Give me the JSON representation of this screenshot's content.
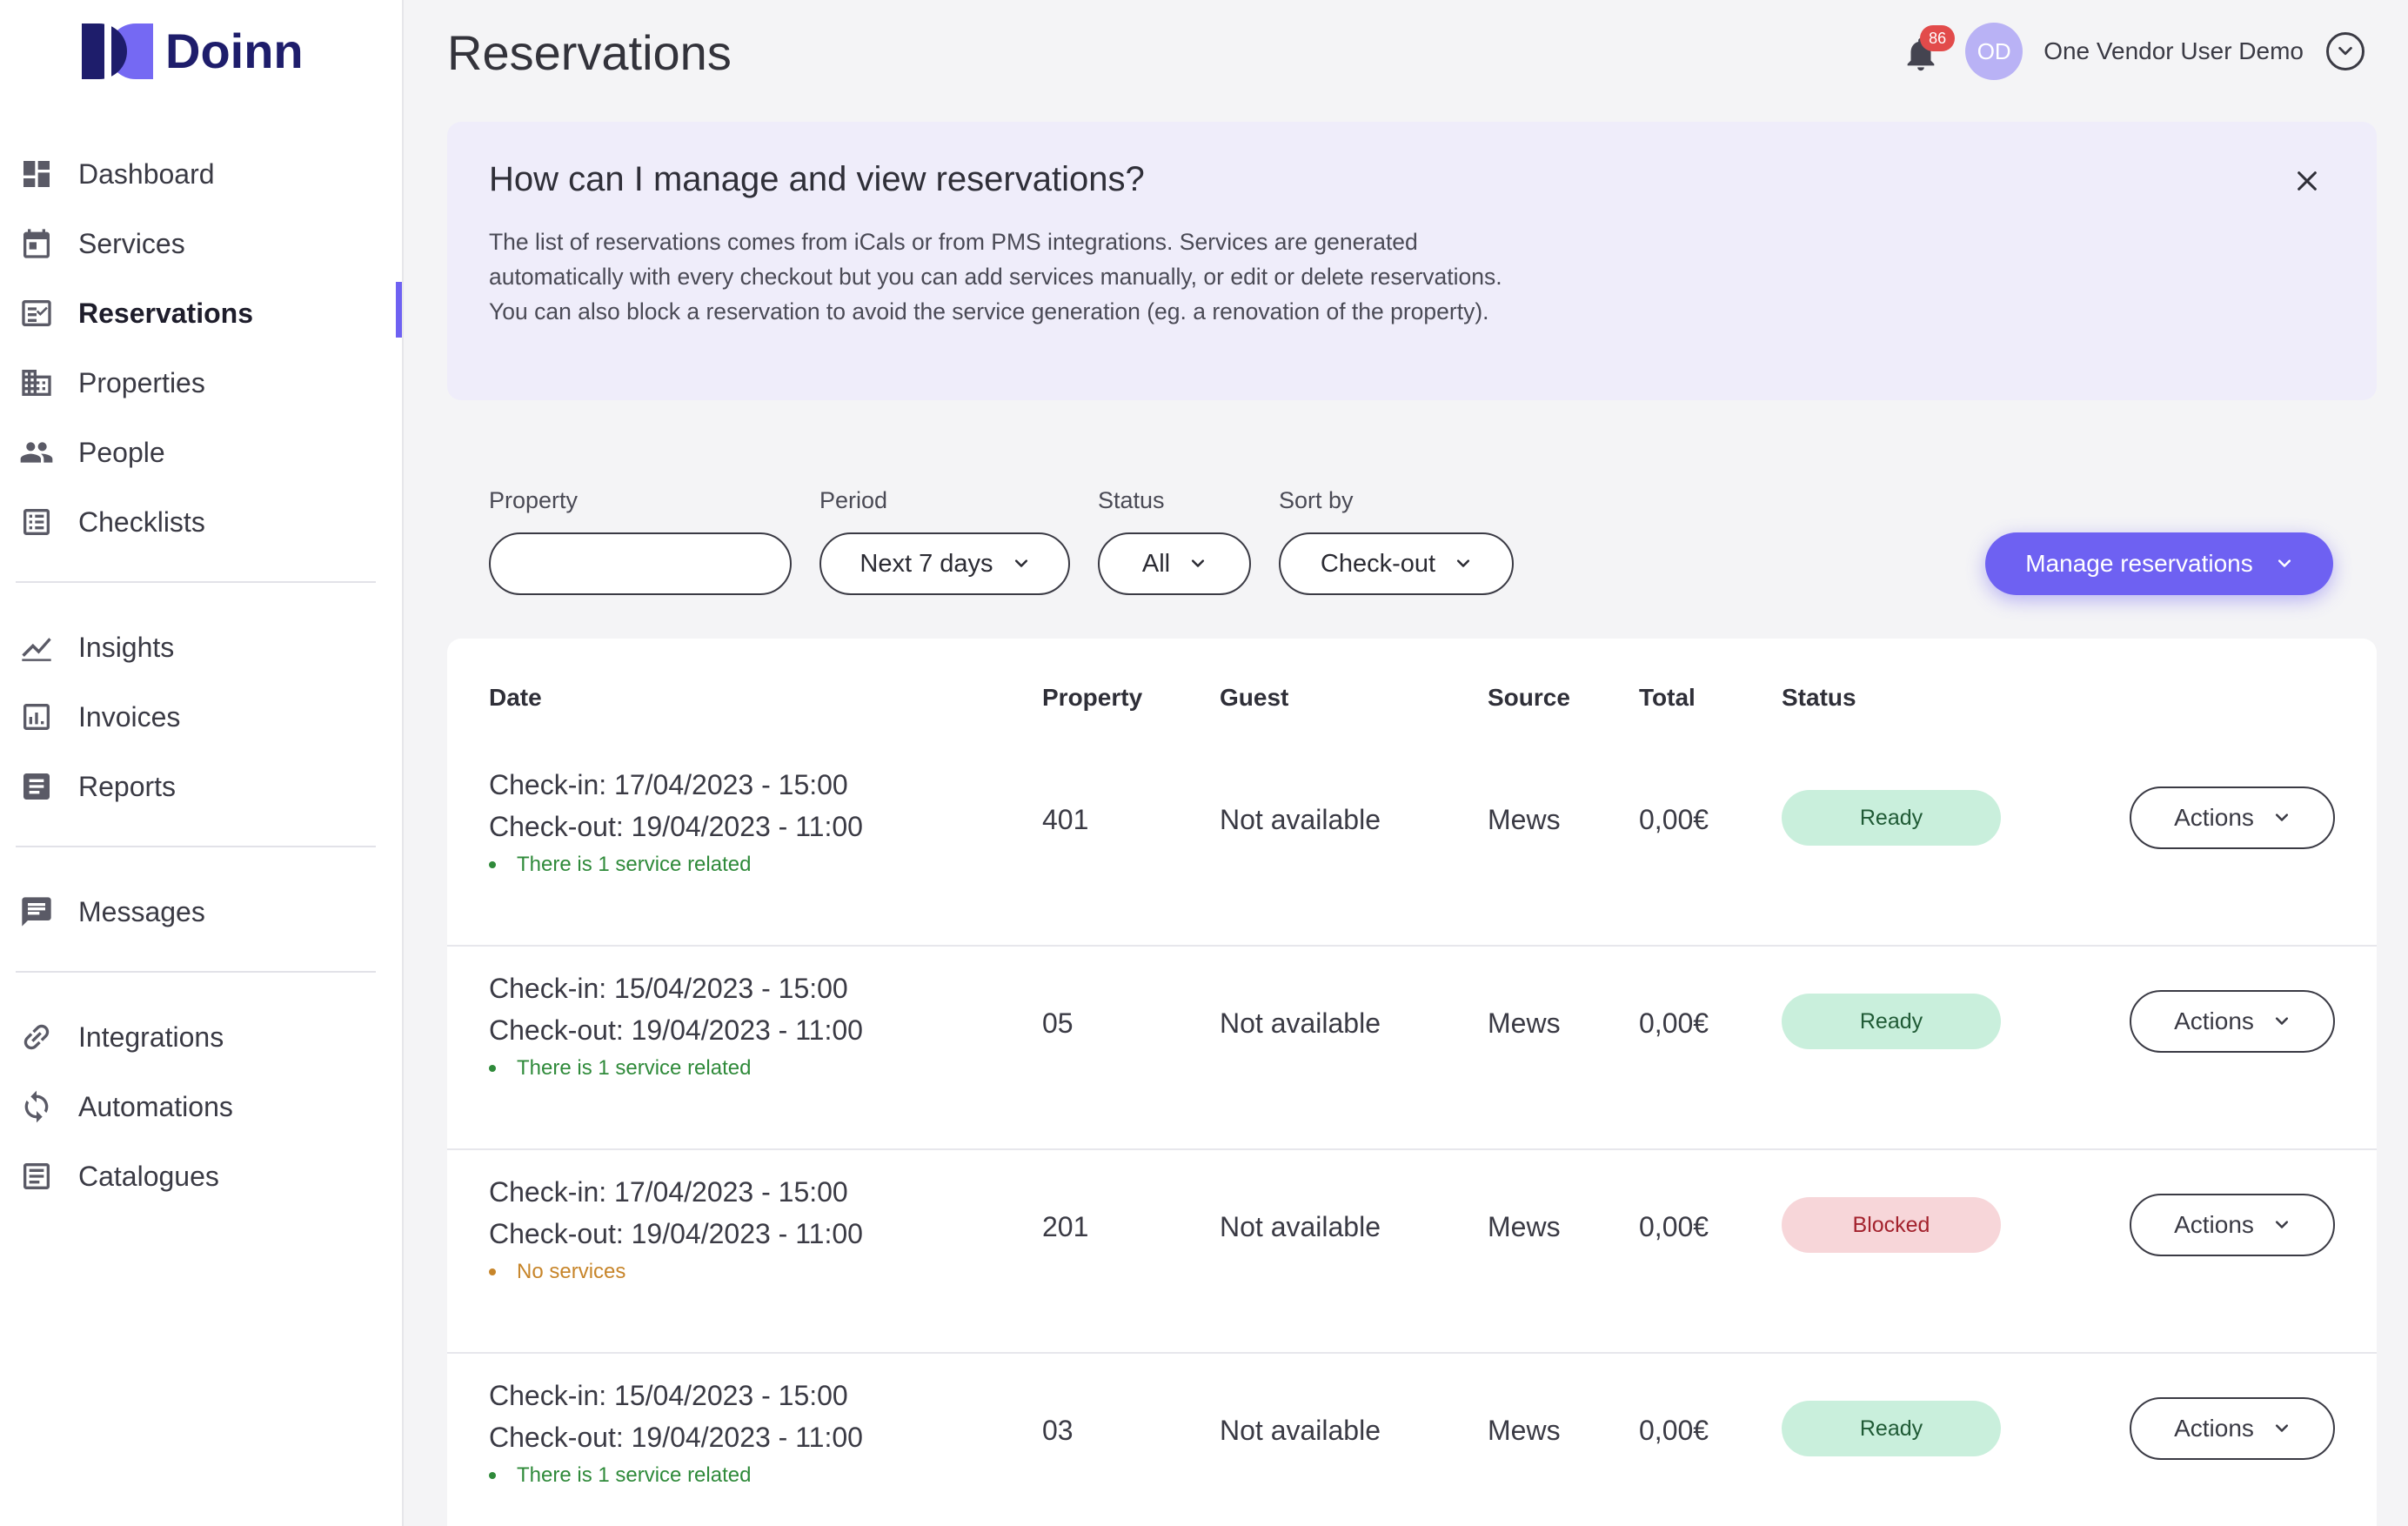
{
  "brand": {
    "name": "Doinn"
  },
  "sidebar": {
    "groups": [
      [
        {
          "label": "Dashboard",
          "icon": "dashboard-icon",
          "active": false
        },
        {
          "label": "Services",
          "icon": "calendar-icon",
          "active": false
        },
        {
          "label": "Reservations",
          "icon": "reservations-icon",
          "active": true
        },
        {
          "label": "Properties",
          "icon": "building-icon",
          "active": false
        },
        {
          "label": "People",
          "icon": "people-icon",
          "active": false
        },
        {
          "label": "Checklists",
          "icon": "checklist-icon",
          "active": false
        }
      ],
      [
        {
          "label": "Insights",
          "icon": "chart-line-icon",
          "active": false
        },
        {
          "label": "Invoices",
          "icon": "invoice-icon",
          "active": false
        },
        {
          "label": "Reports",
          "icon": "report-icon",
          "active": false
        }
      ],
      [
        {
          "label": "Messages",
          "icon": "message-icon",
          "active": false
        }
      ],
      [
        {
          "label": "Integrations",
          "icon": "link-icon",
          "active": false
        },
        {
          "label": "Automations",
          "icon": "sync-icon",
          "active": false
        },
        {
          "label": "Catalogues",
          "icon": "catalogue-icon",
          "active": false
        }
      ]
    ]
  },
  "header": {
    "title": "Reservations",
    "notifications_count": "86",
    "user_initials": "OD",
    "user_name": "One Vendor User Demo"
  },
  "info": {
    "title": "How can I manage and view reservations?",
    "lines": [
      "The list of reservations comes from iCals or from PMS integrations. Services are generated",
      "automatically with every checkout but you can add services manually, or edit or delete reservations.",
      "You can also block a reservation to avoid the service generation (eg. a renovation of the property)."
    ]
  },
  "filters": {
    "property": {
      "label": "Property",
      "value": ""
    },
    "period": {
      "label": "Period",
      "value": "Next 7 days"
    },
    "status": {
      "label": "Status",
      "value": "All"
    },
    "sort_by": {
      "label": "Sort by",
      "value": "Check-out"
    }
  },
  "manage_button": "Manage reservations",
  "table": {
    "headers": {
      "date": "Date",
      "property": "Property",
      "guest": "Guest",
      "source": "Source",
      "total": "Total",
      "status": "Status"
    },
    "rows": [
      {
        "checkin": "Check-in: 17/04/2023 - 15:00",
        "checkout": "Check-out: 19/04/2023 - 11:00",
        "note": "There is 1 service related",
        "note_type": "green",
        "property": "401",
        "guest": "Not available",
        "source": "Mews",
        "total": "0,00€",
        "status": "Ready",
        "status_type": "ready",
        "actions": "Actions"
      },
      {
        "checkin": "Check-in: 15/04/2023 - 15:00",
        "checkout": "Check-out: 19/04/2023 - 11:00",
        "note": "There is 1 service related",
        "note_type": "green",
        "property": "05",
        "guest": "Not available",
        "source": "Mews",
        "total": "0,00€",
        "status": "Ready",
        "status_type": "ready",
        "actions": "Actions"
      },
      {
        "checkin": "Check-in: 17/04/2023 - 15:00",
        "checkout": "Check-out: 19/04/2023 - 11:00",
        "note": "No services",
        "note_type": "orange",
        "property": "201",
        "guest": "Not available",
        "source": "Mews",
        "total": "0,00€",
        "status": "Blocked",
        "status_type": "blocked",
        "actions": "Actions"
      },
      {
        "checkin": "Check-in: 15/04/2023 - 15:00",
        "checkout": "Check-out: 19/04/2023 - 11:00",
        "note": "There is 1 service related",
        "note_type": "green",
        "property": "03",
        "guest": "Not available",
        "source": "Mews",
        "total": "0,00€",
        "status": "Ready",
        "status_type": "ready",
        "actions": "Actions"
      }
    ]
  },
  "colors": {
    "accent": "#6e61f2",
    "brand_dark": "#1e1d6b",
    "ready_bg": "#c9efdc",
    "blocked_bg": "#f7d6d9"
  }
}
